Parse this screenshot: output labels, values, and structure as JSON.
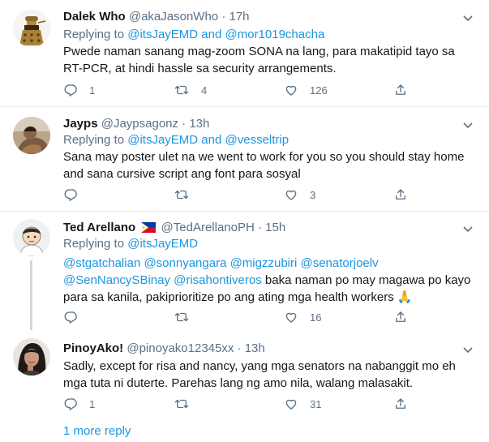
{
  "tweets": [
    {
      "name": "Dalek Who",
      "handle": "@akaJasonWho",
      "separator": "·",
      "time": "17h",
      "replying_prefix": "Replying to",
      "replying_to": [
        "@itsJayEMD",
        "@mor1019chacha"
      ],
      "joiner": "and",
      "text": "Pwede naman sanang mag-zoom SONA na lang, para makatipid tayo sa  RT-PCR, at hindi hassle sa security arrangements.",
      "replies": "1",
      "retweets": "4",
      "likes": "126"
    },
    {
      "name": "Jayps",
      "handle": "@Jaypsagonz",
      "separator": "·",
      "time": "13h",
      "replying_prefix": "Replying to",
      "replying_to": [
        "@itsJayEMD",
        "@vesseltrip"
      ],
      "joiner": "and",
      "text": "Sana may poster ulet na we went to work for you so you should stay home and sana cursive script ang font para sosyal",
      "replies": "",
      "retweets": "",
      "likes": "3"
    },
    {
      "name": "Ted Arellano",
      "handle": "@TedArellanoPH",
      "separator": "·",
      "time": "15h",
      "replying_prefix": "Replying to",
      "replying_to": [
        "@itsJayEMD"
      ],
      "mentions_line1": "@stgatchalian @sonnyangara @migzzubiri @senatorjoelv",
      "mentions_line2": "@SenNancySBinay @risahontiveros",
      "text_line2_rest": " baka naman po may magawa po kayo",
      "text_line3": "para sa kanila, pakiprioritize po ang ating mga health workers",
      "emoji": "🙏",
      "replies": "",
      "retweets": "",
      "likes": "16"
    },
    {
      "name": "PinoyAko!",
      "handle": "@pinoyako12345xx",
      "separator": "·",
      "time": "13h",
      "text": "Sadly, except for risa and nancy, yang mga senators na nabanggit mo eh mga tuta ni duterte. Parehas lang ng amo nila, walang malasakit.",
      "replies": "1",
      "retweets": "",
      "likes": "31"
    }
  ],
  "more_replies": "1 more reply",
  "colors": {
    "link": "#1b95e0",
    "muted": "#5b7083",
    "divider": "#e6ecf0"
  }
}
